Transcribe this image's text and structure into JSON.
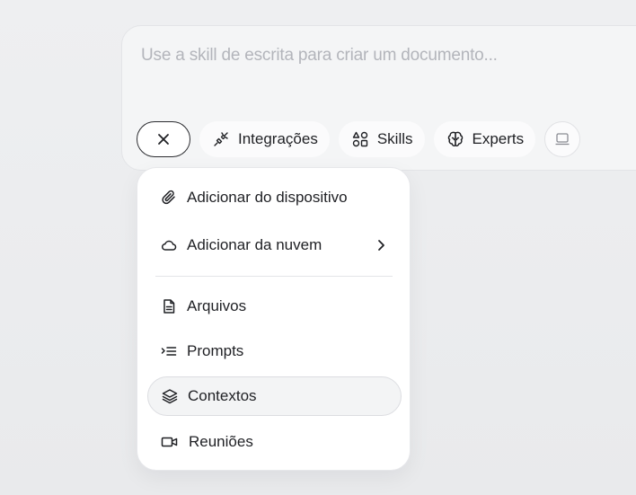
{
  "composer": {
    "placeholder": "Use a skill de escrita para criar um documento..."
  },
  "toolbar": {
    "close_icon": "close-icon",
    "integrations_label": "Integrações",
    "skills_label": "Skills",
    "experts_label": "Experts",
    "device_icon": "laptop-icon"
  },
  "menu": {
    "items": [
      {
        "label": "Adicionar do dispositivo",
        "icon": "paperclip-icon"
      },
      {
        "label": "Adicionar da nuvem",
        "icon": "cloud-icon",
        "has_submenu": true
      },
      {
        "label": "Arquivos",
        "icon": "file-icon"
      },
      {
        "label": "Prompts",
        "icon": "prompt-list-icon"
      },
      {
        "label": "Contextos",
        "icon": "layers-icon",
        "highlighted": true
      },
      {
        "label": "Reuniões",
        "icon": "video-icon"
      }
    ]
  },
  "colors": {
    "background": "#eeeff1",
    "surface": "#ffffff",
    "text": "#1f2024",
    "placeholder": "#b3b5bb"
  }
}
